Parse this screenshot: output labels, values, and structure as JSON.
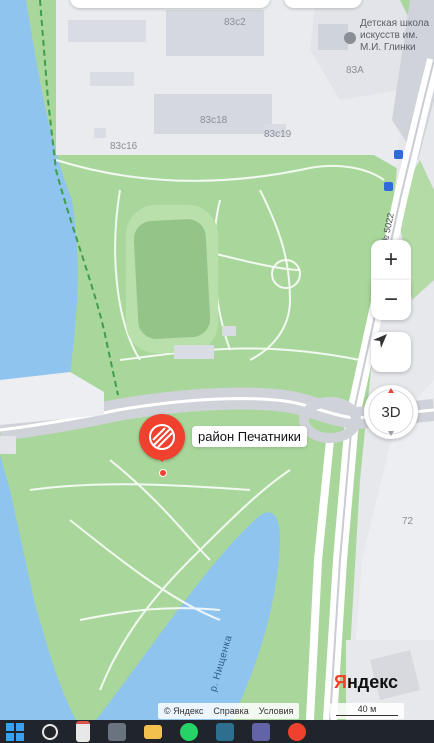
{
  "map": {
    "place_label": "район Печатники",
    "buildings": [
      "83с2",
      "83А",
      "83с18",
      "83с19",
      "83с16"
    ],
    "school_label": "Детская школа искусств им. М.И. Глинки",
    "road_label": "ул. пр-д № 5022",
    "river_label": "р. Нищенка",
    "house_number": "72"
  },
  "controls": {
    "zoom_in": "+",
    "zoom_out": "−",
    "view_3d": "3D"
  },
  "footer": {
    "copyright": "© Яндекс",
    "help": "Справка",
    "terms": "Условия",
    "scale": "40 м"
  },
  "logo": {
    "first": "Я",
    "rest": "ндекс"
  },
  "colors": {
    "park": "#a9d79b",
    "water": "#8ec4ee",
    "industrial": "#e9ebef",
    "road": "#ffffff",
    "accent": "#f0412e"
  },
  "taskbar": {
    "icons": [
      "windows-icon",
      "search-icon",
      "file-icon",
      "calculator-icon",
      "folder-icon",
      "whatsapp-icon",
      "app-icon",
      "teams-icon",
      "yandex-browser-icon"
    ]
  }
}
